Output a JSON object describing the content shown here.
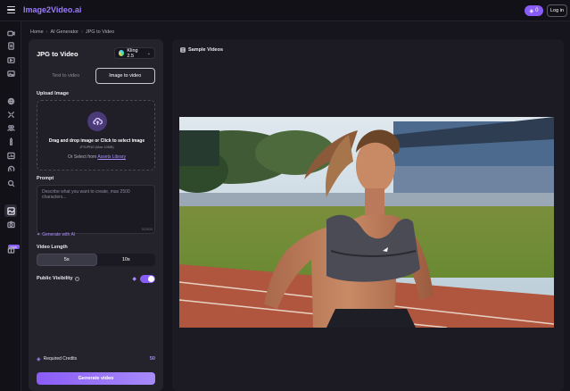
{
  "app": {
    "logo_text": "Image2Video.ai",
    "credits": "0",
    "login_label": "Log in",
    "accent_color": "#8a5cf6"
  },
  "sidebar": {
    "icons": [
      "video-icon",
      "document-icon",
      "film-icon",
      "image-icon",
      "globe-icon",
      "expand-icon",
      "people-icon",
      "torch-icon",
      "chart-icon",
      "face-icon",
      "search-icon",
      "image-to-video-icon",
      "camera-icon",
      "gift-icon"
    ],
    "badge": "NEW"
  },
  "breadcrumb": [
    "Home",
    "AI Generator",
    "JPG to Video"
  ],
  "left": {
    "title": "JPG to Video",
    "model": "Kling 2.5",
    "tabs": [
      "Text to video",
      "Image to video"
    ],
    "upload_label": "Upload Image",
    "upload_main": "Drag and drop image or Click to select image",
    "upload_formats": "JPG/PNG (Max 10MB)",
    "upload_alt_prefix": "Or Select from",
    "upload_alt_link": "Assets Library",
    "prompt_label": "Prompt",
    "prompt_placeholder": "Describe what you want to create, max 2500 characters...",
    "prompt_count": "0/2500",
    "generate_ai": "Generate with AI",
    "length_label": "Video Length",
    "length_options": [
      "5s",
      "10s"
    ],
    "visibility_label": "Public Visibility",
    "credits_label": "Required Credits",
    "credits_value": "50",
    "generate_button": "Generate video"
  },
  "right": {
    "title": "Sample Videos"
  }
}
